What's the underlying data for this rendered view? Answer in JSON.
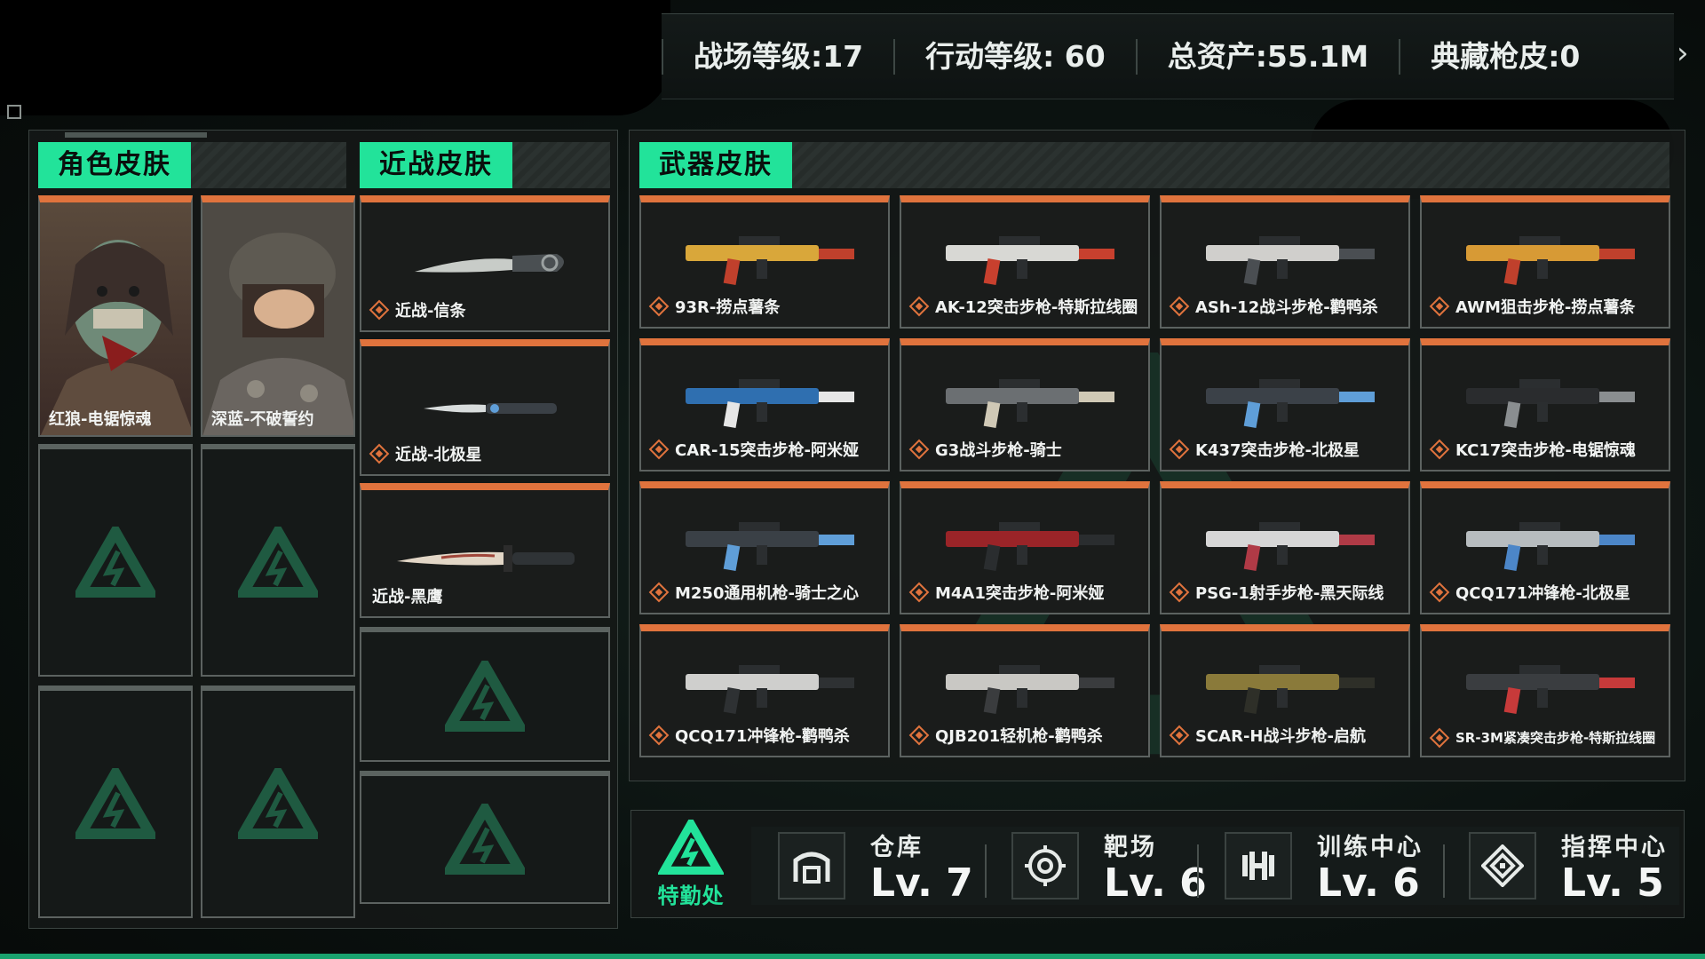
{
  "stats": [
    {
      "label": "战场等级:17"
    },
    {
      "label": "行动等级: 60"
    },
    {
      "label": "总资产:55.1M"
    },
    {
      "label": "典藏枪皮:0"
    }
  ],
  "sections": {
    "character": {
      "title": "角色皮肤",
      "items": [
        "红狼-电锯惊魂",
        "深蓝-不破誓约"
      ]
    },
    "melee": {
      "title": "近战皮肤",
      "items": [
        "近战-信条",
        "近战-北极星",
        "近战-黑鹰"
      ]
    },
    "weapons": {
      "title": "武器皮肤",
      "items": [
        "93R-捞点薯条",
        "AK-12突击步枪-特斯拉线圈",
        "ASh-12战斗步枪-鹳鸭杀",
        "AWM狙击步枪-捞点薯条",
        "CAR-15突击步枪-阿米娅",
        "G3战斗步枪-骑士",
        "K437突击步枪-北极星",
        "KC17突击步枪-电锯惊魂",
        "M250通用机枪-骑士之心",
        "M4A1突击步枪-阿米娅",
        "PSG-1射手步枪-黑天际线",
        "QCQ171冲锋枪-北极星",
        "QCQ171冲锋枪-鹳鸭杀",
        "QJB201轻机枪-鹳鸭杀",
        "SCAR-H战斗步枪-启航",
        "SR-3M紧凑突击步枪-特斯拉线圈"
      ]
    }
  },
  "base": {
    "name": "特勤处"
  },
  "facilities": [
    {
      "name": "仓库",
      "level": "Lv. 7",
      "icon": "warehouse-icon"
    },
    {
      "name": "靶场",
      "level": "Lv. 6",
      "icon": "target-icon"
    },
    {
      "name": "训练中心",
      "level": "Lv. 6",
      "icon": "dumbbell-icon"
    },
    {
      "name": "指挥中心",
      "level": "Lv. 5",
      "icon": "command-icon"
    }
  ],
  "colors": {
    "accent": "#22e39a",
    "card_top": "#e0733d"
  }
}
